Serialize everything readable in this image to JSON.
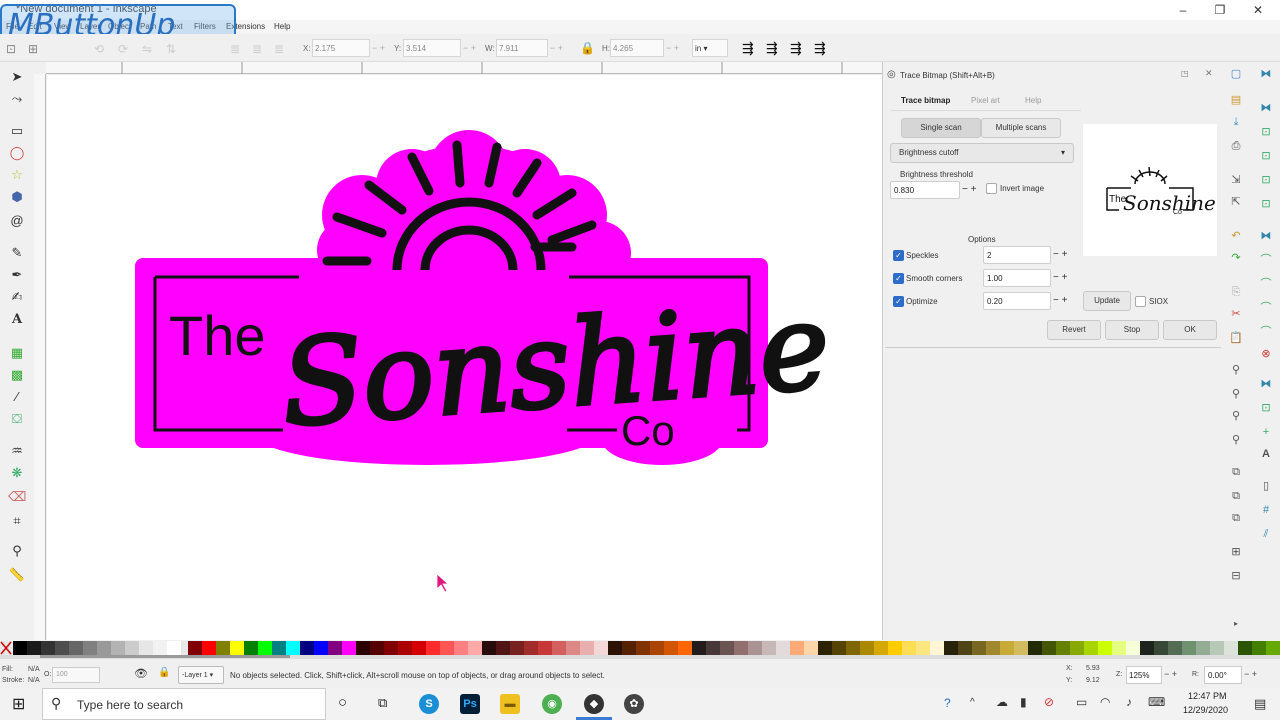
{
  "window": {
    "title": "*New document 1 - Inkscape",
    "watermark": "MButtonUp",
    "controls": {
      "minimize": "–",
      "maximize": "❐",
      "close": "✕"
    }
  },
  "menu": {
    "items": [
      "File",
      "Edit",
      "View",
      "Layer",
      "Object",
      "Path",
      "Text",
      "Filters",
      "Extensions",
      "Help"
    ]
  },
  "toolbar": {
    "x_label": "X:",
    "x_value": "2.175",
    "y_label": "Y:",
    "y_value": "3.514",
    "w_label": "W:",
    "w_value": "7.911",
    "h_label": "H:",
    "h_value": "4.265",
    "unit": "in"
  },
  "dialog": {
    "title": "Trace Bitmap (Shift+Alt+B)",
    "tabs": [
      "Trace bitmap",
      "Pixel art",
      "Help"
    ],
    "scan_modes": [
      "Single scan",
      "Multiple scans"
    ],
    "mode_select": "Brightness cutoff",
    "threshold_label": "Brightness threshold",
    "threshold_value": "0.830",
    "invert_label": "Invert image",
    "options_heading": "Options",
    "options": [
      {
        "label": "Speckles",
        "value": "2",
        "checked": true
      },
      {
        "label": "Smooth corners",
        "value": "1.00",
        "checked": true
      },
      {
        "label": "Optimize",
        "value": "0.20",
        "checked": true
      }
    ],
    "update_label": "Update",
    "siox_label": "SIOX",
    "revert_label": "Revert",
    "stop_label": "Stop",
    "ok_label": "OK"
  },
  "artwork": {
    "text_the": "The",
    "text_main": "Sonshine",
    "text_co": "Co",
    "fill_color": "#ff00ff",
    "ink_color": "#111111"
  },
  "status": {
    "fill_label": "Fill:",
    "fill_value": "N/A",
    "stroke_label": "Stroke:",
    "stroke_value": "N/A",
    "opacity_label": "O:",
    "opacity_value": "100",
    "layer": "-Layer 1",
    "message": "No objects selected. Click, Shift+click, Alt+scroll mouse on top of objects, or drag around objects to select.",
    "coord_x_label": "X:",
    "coord_x": "5.93",
    "coord_y_label": "Y:",
    "coord_y": "9.12",
    "zoom_label": "Z:",
    "zoom": "125%",
    "rotate_label": "R:",
    "rotate": "0.00°"
  },
  "taskbar": {
    "search_placeholder": "Type here to search",
    "time": "12:47 PM",
    "date": "12/29/2020"
  }
}
